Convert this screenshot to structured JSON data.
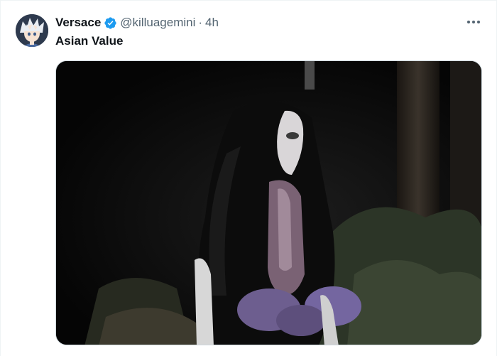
{
  "tweet": {
    "display_name": "Versace",
    "verified": true,
    "handle": "@killuagemini",
    "separator": "·",
    "time": "4h",
    "text": "Asian Value",
    "avatar_icon": "anime-avatar-icon",
    "more_icon": "more-options-icon",
    "media_description_icon": "photo-dark-forest-figure-icon"
  },
  "colors": {
    "verified_blue": "#1d9bf0",
    "secondary_text": "#536471",
    "primary_text": "#0f1419"
  }
}
